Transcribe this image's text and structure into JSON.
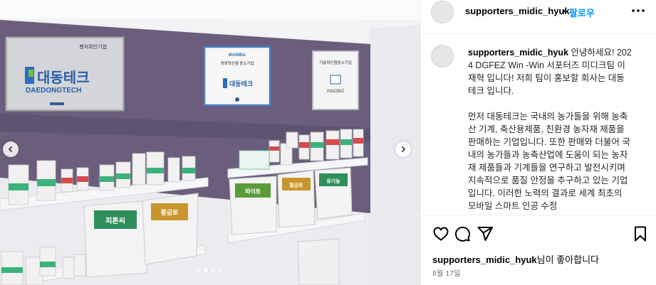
{
  "post": {
    "username": "supporters_midic_hyuk",
    "follow_label": "팔로우",
    "caption": "안녕하세요! 2024 DGFEZ Win -Win 서포터즈 미디크팀 이재혁 입니다! 저희 팀이 홍보할 회사는 대동테크 입니다.\n\n먼저 대동테크는 국내의 농가들을 위해 농축산 기계, 축산용제품, 친환경 농자재 제품을 판매하는 기업입니다. 또한 판매와 더불어 국내의 농가들과 농축산업에 도움이 되는 농자재 제품들과 기계들을 연구하고 발전시키며 지속적으로 품질 안정을 추구하고 있는 기업입니다. 이러한 노력의 결과로 세계 최초의 모바일 스마트 인공 수정",
    "likes_user": "supporters_midic_hyuk",
    "likes_suffix": "님이 좋아합니다",
    "date": "8월 17일"
  },
  "photo_signs": {
    "company_name_kr": "대동테크",
    "company_name_en": "DAEDONGTECH",
    "plaque1_title": "벤처확인기업",
    "plaque2_brand": "MAINBiz",
    "plaque2_title": "경영혁신형 중소기업",
    "plaque2_company": "대동테크",
    "plaque3_title": "기술혁신형중소기업",
    "plaque3_brand": "INNOBIZ",
    "bag_labels": [
      "피톤씨",
      "황금토",
      "파이토",
      "황금토",
      "유기농"
    ]
  },
  "carousel": {
    "slides": 4,
    "active": 1
  },
  "icons": {
    "more": "more-horizontal-icon",
    "like": "heart-icon",
    "comment": "comment-icon",
    "share": "send-icon",
    "save": "bookmark-icon",
    "prev": "chevron-left-icon",
    "next": "chevron-right-icon"
  },
  "colors": {
    "follow": "#0095f6",
    "wall": "#6b5f7e",
    "date": "#737373"
  }
}
